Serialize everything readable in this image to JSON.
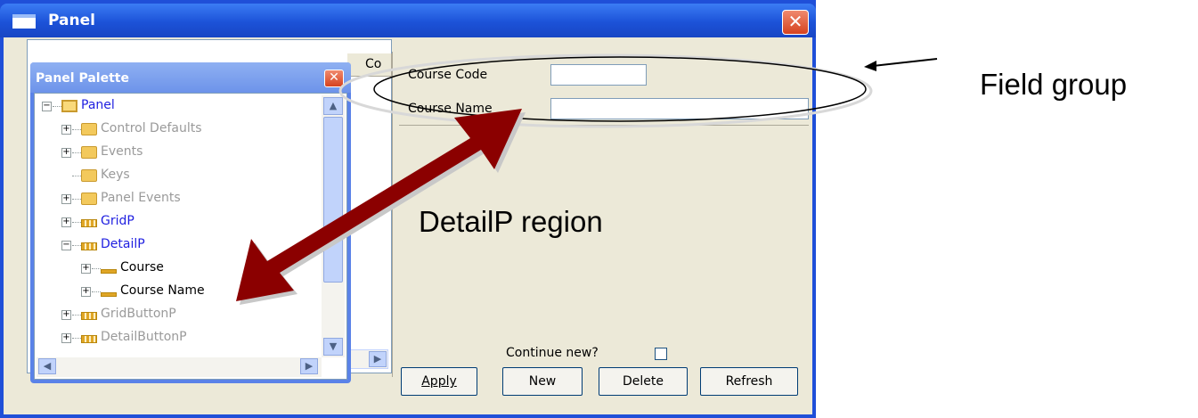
{
  "window": {
    "title": "Panel",
    "close_glyph": "✕"
  },
  "palette": {
    "title": "Panel Palette",
    "close_glyph": "✕",
    "tree": [
      {
        "label": "Panel",
        "color": "blue",
        "icon": "panel-icon",
        "expander": "minus"
      },
      {
        "label": "Control Defaults",
        "color": "gray",
        "icon": "folder-icon",
        "expander": "plus"
      },
      {
        "label": "Events",
        "color": "gray",
        "icon": "folder-icon",
        "expander": "plus"
      },
      {
        "label": "Keys",
        "color": "gray",
        "icon": "folder-icon",
        "expander": "none"
      },
      {
        "label": "Panel Events",
        "color": "gray",
        "icon": "folder-icon",
        "expander": "plus"
      },
      {
        "label": "GridP",
        "color": "blue",
        "icon": "grid-icon",
        "expander": "plus"
      },
      {
        "label": "DetailP",
        "color": "blue",
        "icon": "grid-icon",
        "expander": "minus"
      },
      {
        "label": "Course",
        "color": "black",
        "icon": "field-icon",
        "expander": "plus"
      },
      {
        "label": "Course Name",
        "color": "black",
        "icon": "field-icon",
        "expander": "plus"
      },
      {
        "label": "GridButtonP",
        "color": "gray",
        "icon": "grid-icon",
        "expander": "plus"
      },
      {
        "label": "DetailButtonP",
        "color": "gray",
        "icon": "grid-icon",
        "expander": "plus"
      }
    ]
  },
  "grid": {
    "column_header": "Co"
  },
  "detail": {
    "course_code_label": "Course Code",
    "course_code_value": "",
    "course_name_label": "Course Name",
    "course_name_value": "",
    "continue_label": "Continue new?"
  },
  "buttons": {
    "apply": "Apply",
    "new": "New",
    "delete": "Delete",
    "refresh": "Refresh"
  },
  "annotations": {
    "field_group": "Field group",
    "detailp_region": "DetailP region"
  },
  "colors": {
    "arrow": "#8b0000",
    "titlebar": "#1c52d8",
    "tree_blue": "#1f1fe0",
    "tree_gray": "#9a9a9a"
  }
}
